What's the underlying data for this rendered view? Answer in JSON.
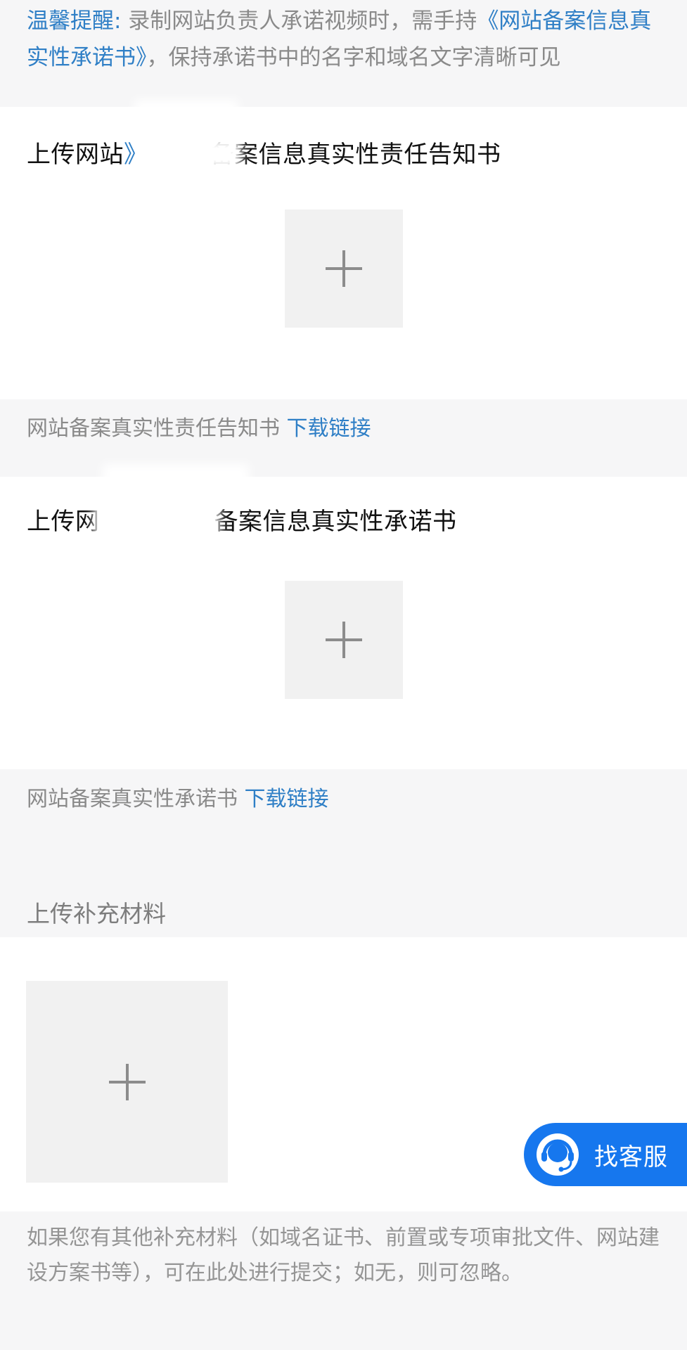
{
  "reminder": {
    "label": "温馨提醒:",
    "text": " 录制网站负责人承诺视频时，需手持",
    "link": "《网站备案信息真实性承诺书》",
    "suffix": "，保持承诺书中的名字和域名文字清晰可见"
  },
  "section1": {
    "title_start": "上传网站",
    "title_mark": "》",
    "title_end": "备案信息真实性责任告知书",
    "add_icon": "plus-icon"
  },
  "note1": {
    "text": "网站备案真实性责任告知书 ",
    "link": "下载链接"
  },
  "section2": {
    "title_start": "上传网",
    "title_end": "备案信息真实性承诺书",
    "add_icon": "plus-icon"
  },
  "note2": {
    "text": "网站备案真实性承诺书 ",
    "link": "下载链接"
  },
  "supplement": {
    "title": "上传补充材料",
    "add_icon": "plus-icon",
    "description": "如果您有其他补充材料（如域名证书、前置或专项审批文件、网站建设方案书等），可在此处进行提交；如无，则可忽略。"
  },
  "service": {
    "label": "找客服",
    "icon": "headset-icon"
  },
  "colors": {
    "link": "#2f7fc6",
    "service_bg": "#1677ee",
    "page_bg": "#f6f6f7"
  }
}
